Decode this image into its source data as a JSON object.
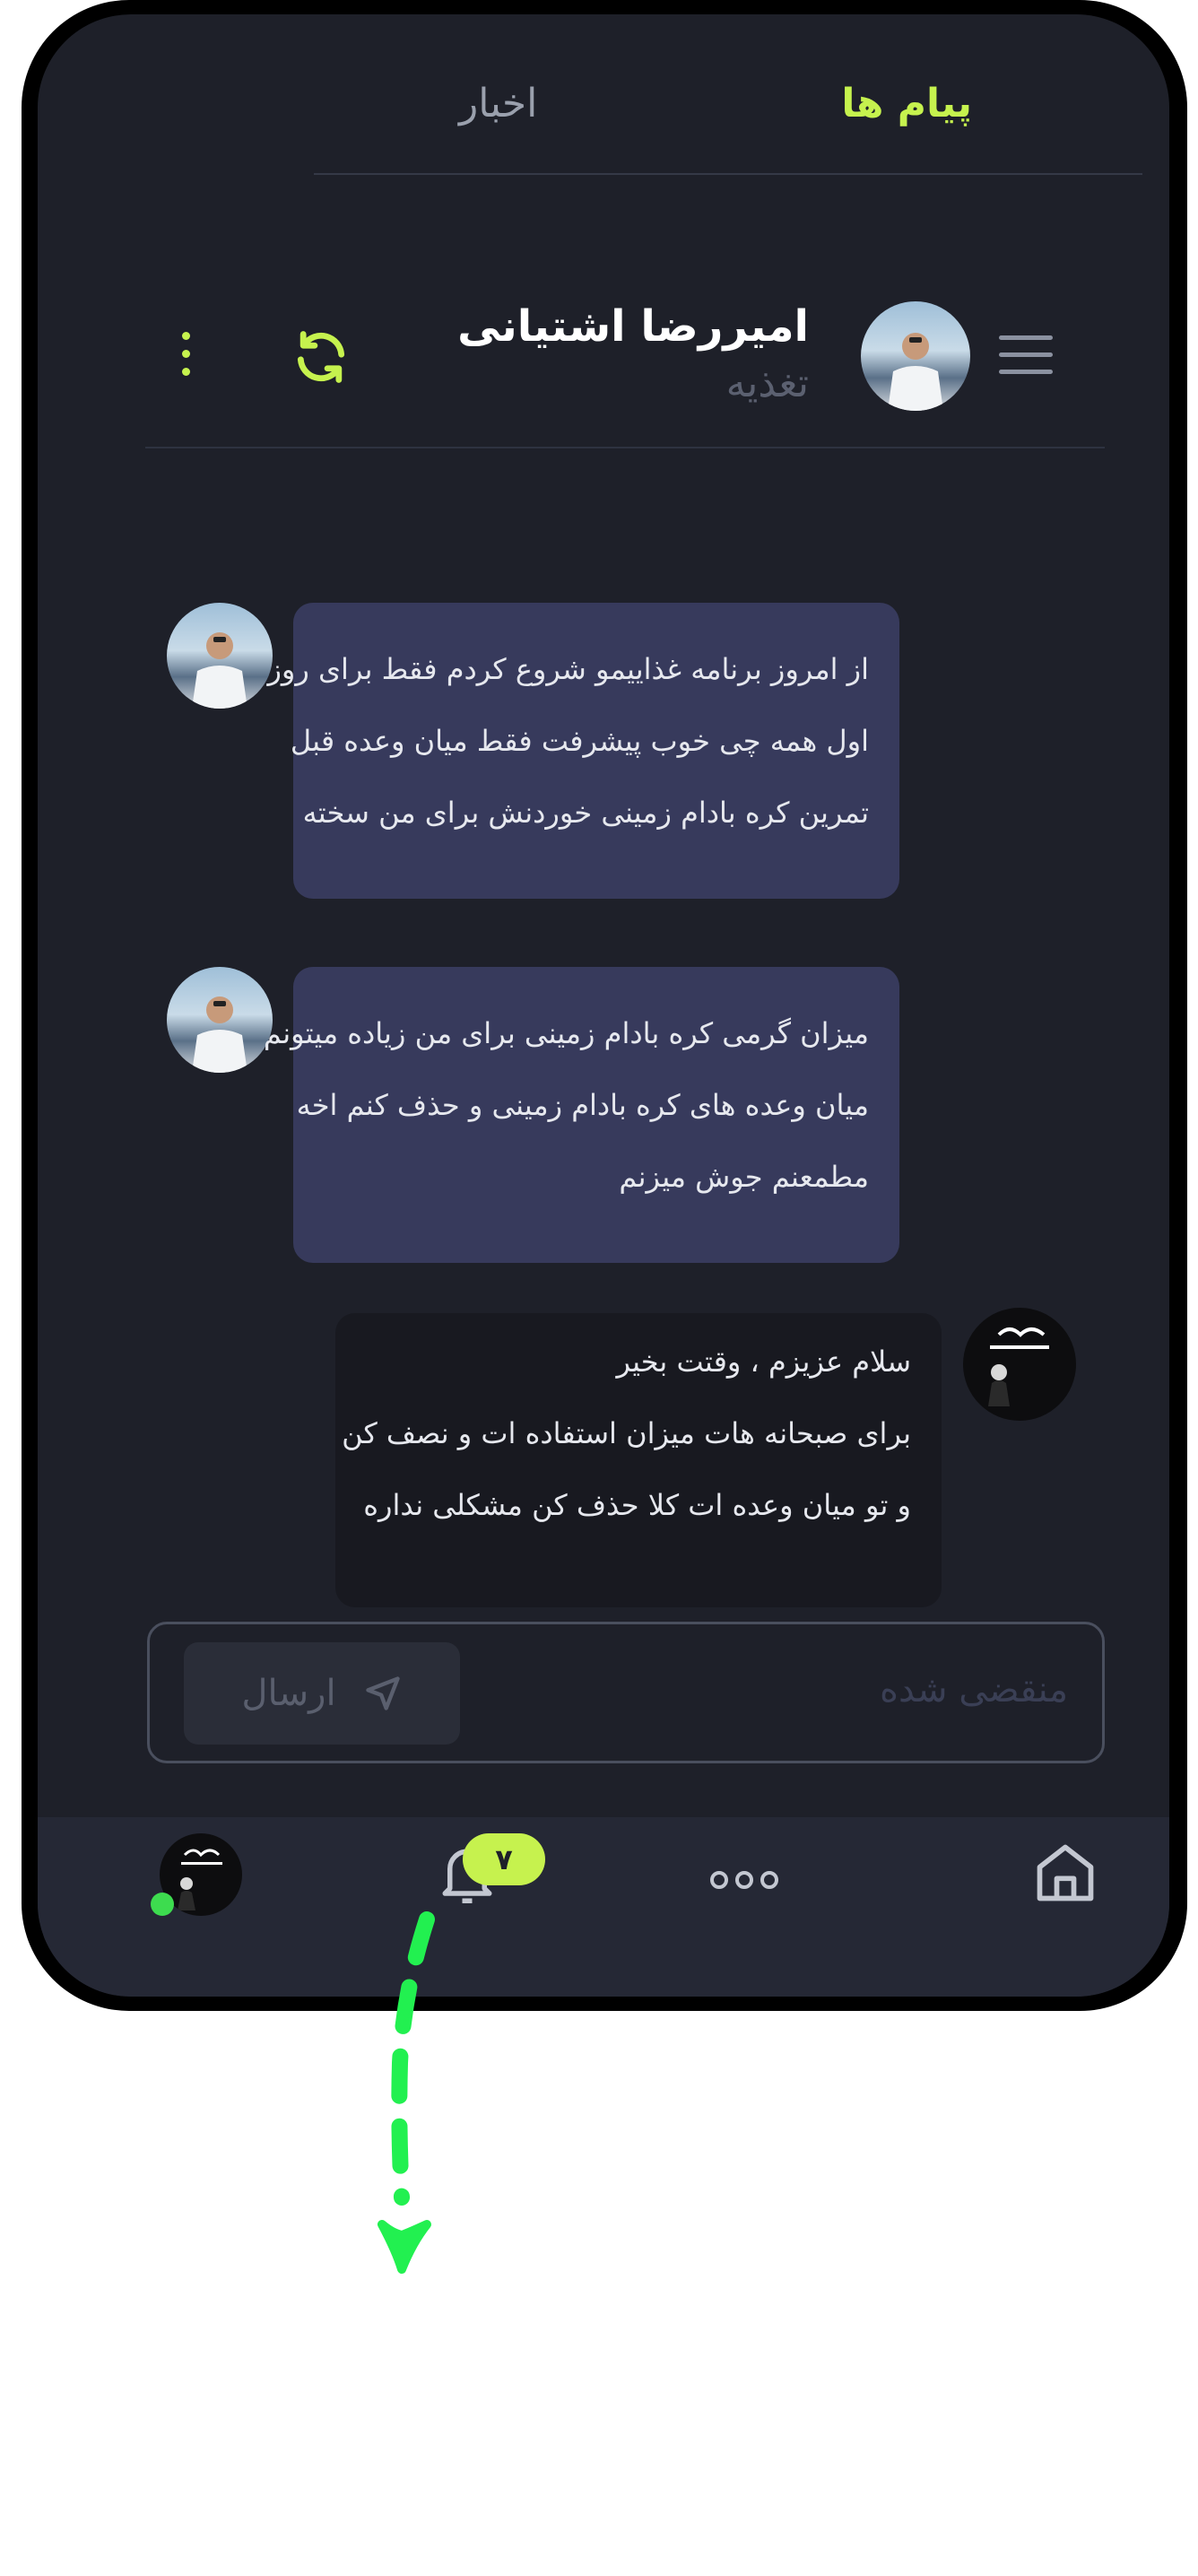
{
  "tabs": {
    "messages": "پیام ها",
    "news": "اخبار"
  },
  "contact": {
    "name": "امیررضا اشتیانی",
    "subtitle": "تغذیه"
  },
  "messages": [
    {
      "direction": "incoming",
      "lines": [
        "از امروز برنامه غذاییمو شروع کردم فقط برای روز",
        "اول همه چی خوب پیشرفت فقط میان وعده قبل",
        "تمرین کره بادام زمینی خوردنش برای من سخته"
      ]
    },
    {
      "direction": "incoming",
      "lines": [
        "میزان گرمی کره بادام زمینی برای من زیاده میتونم",
        "میان وعده های کره بادام زمینی و حذف کنم اخه",
        "مطمعنم جوش میزنم"
      ]
    },
    {
      "direction": "outgoing",
      "lines": [
        "سلام عزیزم ، وقتت بخیر",
        "برای صبحانه هات میزان استفاده ات و نصف کن",
        "و تو میان وعده ات کلا حذف کن مشکلی نداره"
      ]
    }
  ],
  "composer": {
    "placeholder": "منقضی شده",
    "send_label": "ارسال"
  },
  "nav": {
    "notification_count": "۷"
  },
  "colors": {
    "accent": "#c6f24e",
    "background": "#1e2029",
    "incoming_bubble": "#373a5c",
    "outgoing_bubble": "#181920",
    "online": "#3ddc4f",
    "gesture_arrow": "#22f050"
  },
  "icons": [
    "menu-icon",
    "refresh-icon",
    "more-vert-icon",
    "send-icon",
    "home-icon",
    "more-dots-icon",
    "bell-icon"
  ]
}
